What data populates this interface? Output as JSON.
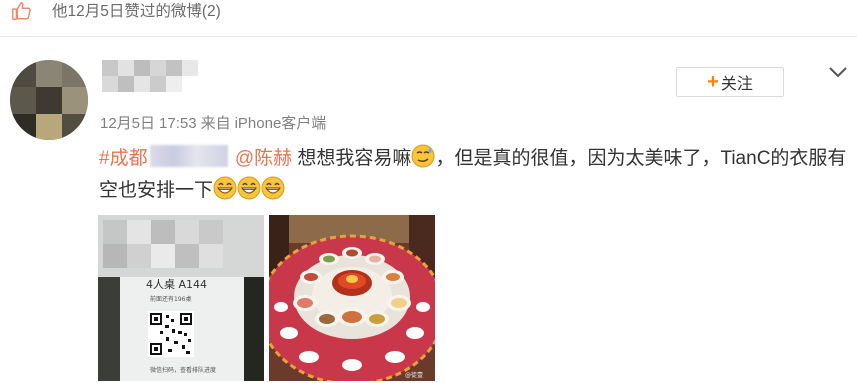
{
  "header": {
    "title": "他12月5日赞过的微博(2)"
  },
  "post": {
    "follow_label": "关注",
    "meta": {
      "date": "12月5日",
      "time": "17:53",
      "source_prefix": "来自",
      "source": "iPhone客户端"
    },
    "text": {
      "hashtag": "#成都",
      "mention": "@陈赫",
      "part1": " 想想我容易嘛",
      "part2": "，但是真的很值，因为太美味了，TianC的衣服有空也安排一下"
    },
    "images": [
      {
        "caption_number": "4人桌 A144",
        "caption_line2": "前面还有196桌",
        "footer": "微信扫码，查看排队进度"
      },
      {
        "footer": "@徒壹"
      }
    ]
  },
  "colors": {
    "link": "#eb7350",
    "accent_orange": "#ff8200",
    "meta_gray": "#808080",
    "text": "#333333"
  },
  "icons": [
    "thumbs-up-icon",
    "plus-icon",
    "chevron-down-icon",
    "sweat-emoji-icon",
    "grin-emoji-icon"
  ]
}
